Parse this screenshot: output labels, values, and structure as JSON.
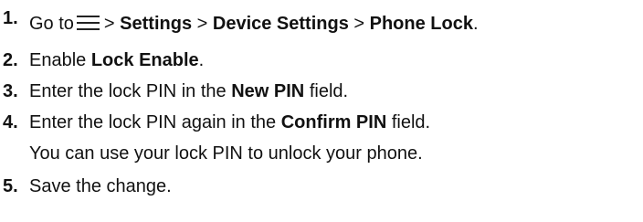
{
  "steps": [
    {
      "number": "1.",
      "parts": [
        "Go to",
        "> ",
        "Settings",
        " > ",
        "Device Settings",
        " > ",
        "Phone Lock",
        "."
      ],
      "icon": "menu-icon"
    },
    {
      "number": "2.",
      "parts": [
        "Enable ",
        "Lock Enable",
        "."
      ]
    },
    {
      "number": "3.",
      "parts": [
        "Enter the lock PIN in the ",
        "New PIN",
        " field."
      ]
    },
    {
      "number": "4.",
      "parts": [
        "Enter the lock PIN again in the ",
        "Confirm PIN",
        " field."
      ],
      "note": "You can use your lock PIN to unlock your phone."
    },
    {
      "number": "5.",
      "parts": [
        "Save the change."
      ]
    }
  ]
}
